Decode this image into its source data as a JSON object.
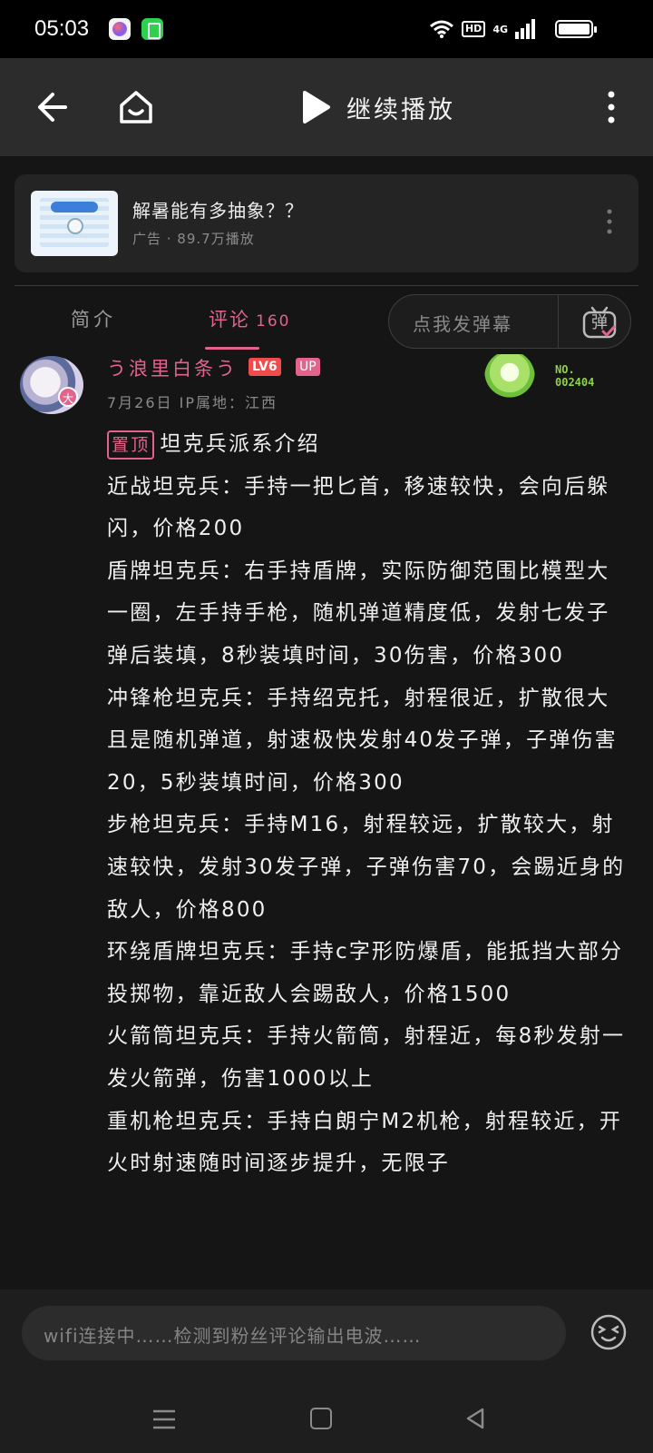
{
  "status_bar": {
    "time": "05:03",
    "hd_label": "HD",
    "network_label": "4G"
  },
  "header": {
    "continue_label": "继续播放"
  },
  "ad": {
    "title": "解暑能有多抽象？？",
    "meta": "广告 · 89.7万播放"
  },
  "tabs": {
    "intro_label": "简介",
    "comments_label": "评论",
    "comments_count": "160"
  },
  "danmaku": {
    "placeholder": "点我发弹幕",
    "button_char": "弹"
  },
  "comment": {
    "avatar_badge": "大",
    "username": "う浪里白条う",
    "level": "LV6",
    "up_tag": "UP",
    "meta": "7月26日  IP属地：江西",
    "fan_number_label": "NO.",
    "fan_number": "002404",
    "pinned_label": "置顶",
    "text": "坦克兵派系介绍\n近战坦克兵：手持一把匕首，移速较快，会向后躲闪，价格200\n盾牌坦克兵：右手持盾牌，实际防御范围比模型大一圈，左手持手枪，随机弹道精度低，发射七发子弹后装填，8秒装填时间，30伤害，价格300\n冲锋枪坦克兵：手持绍克托，射程很近，扩散很大且是随机弹道，射速极快发射40发子弹，子弹伤害20，5秒装填时间，价格300\n步枪坦克兵：手持M16，射程较远，扩散较大，射速较快，发射30发子弹，子弹伤害70，会踢近身的敌人，价格800\n环绕盾牌坦克兵：手持c字形防爆盾，能抵挡大部分投掷物，靠近敌人会踢敌人，价格1500\n火箭筒坦克兵：手持火箭筒，射程近，每8秒发射一发火箭弹，伤害1000以上\n重机枪坦克兵：手持白朗宁M2机枪，射程较近，开火时射速随时间逐步提升，无限子"
  },
  "input": {
    "placeholder": "wifi连接中……检测到粉丝评论输出电波……"
  },
  "colors": {
    "accent_pink": "#e2638c",
    "background": "#151515",
    "header_bg": "#2c2c2c"
  },
  "icons": [
    "back-arrow-icon",
    "home-icon",
    "play-icon",
    "more-vertical-icon",
    "danmaku-icon",
    "emoji-icon",
    "nav-menu-icon",
    "nav-home-icon",
    "nav-back-icon",
    "wifi-icon",
    "signal-icon",
    "battery-icon"
  ]
}
